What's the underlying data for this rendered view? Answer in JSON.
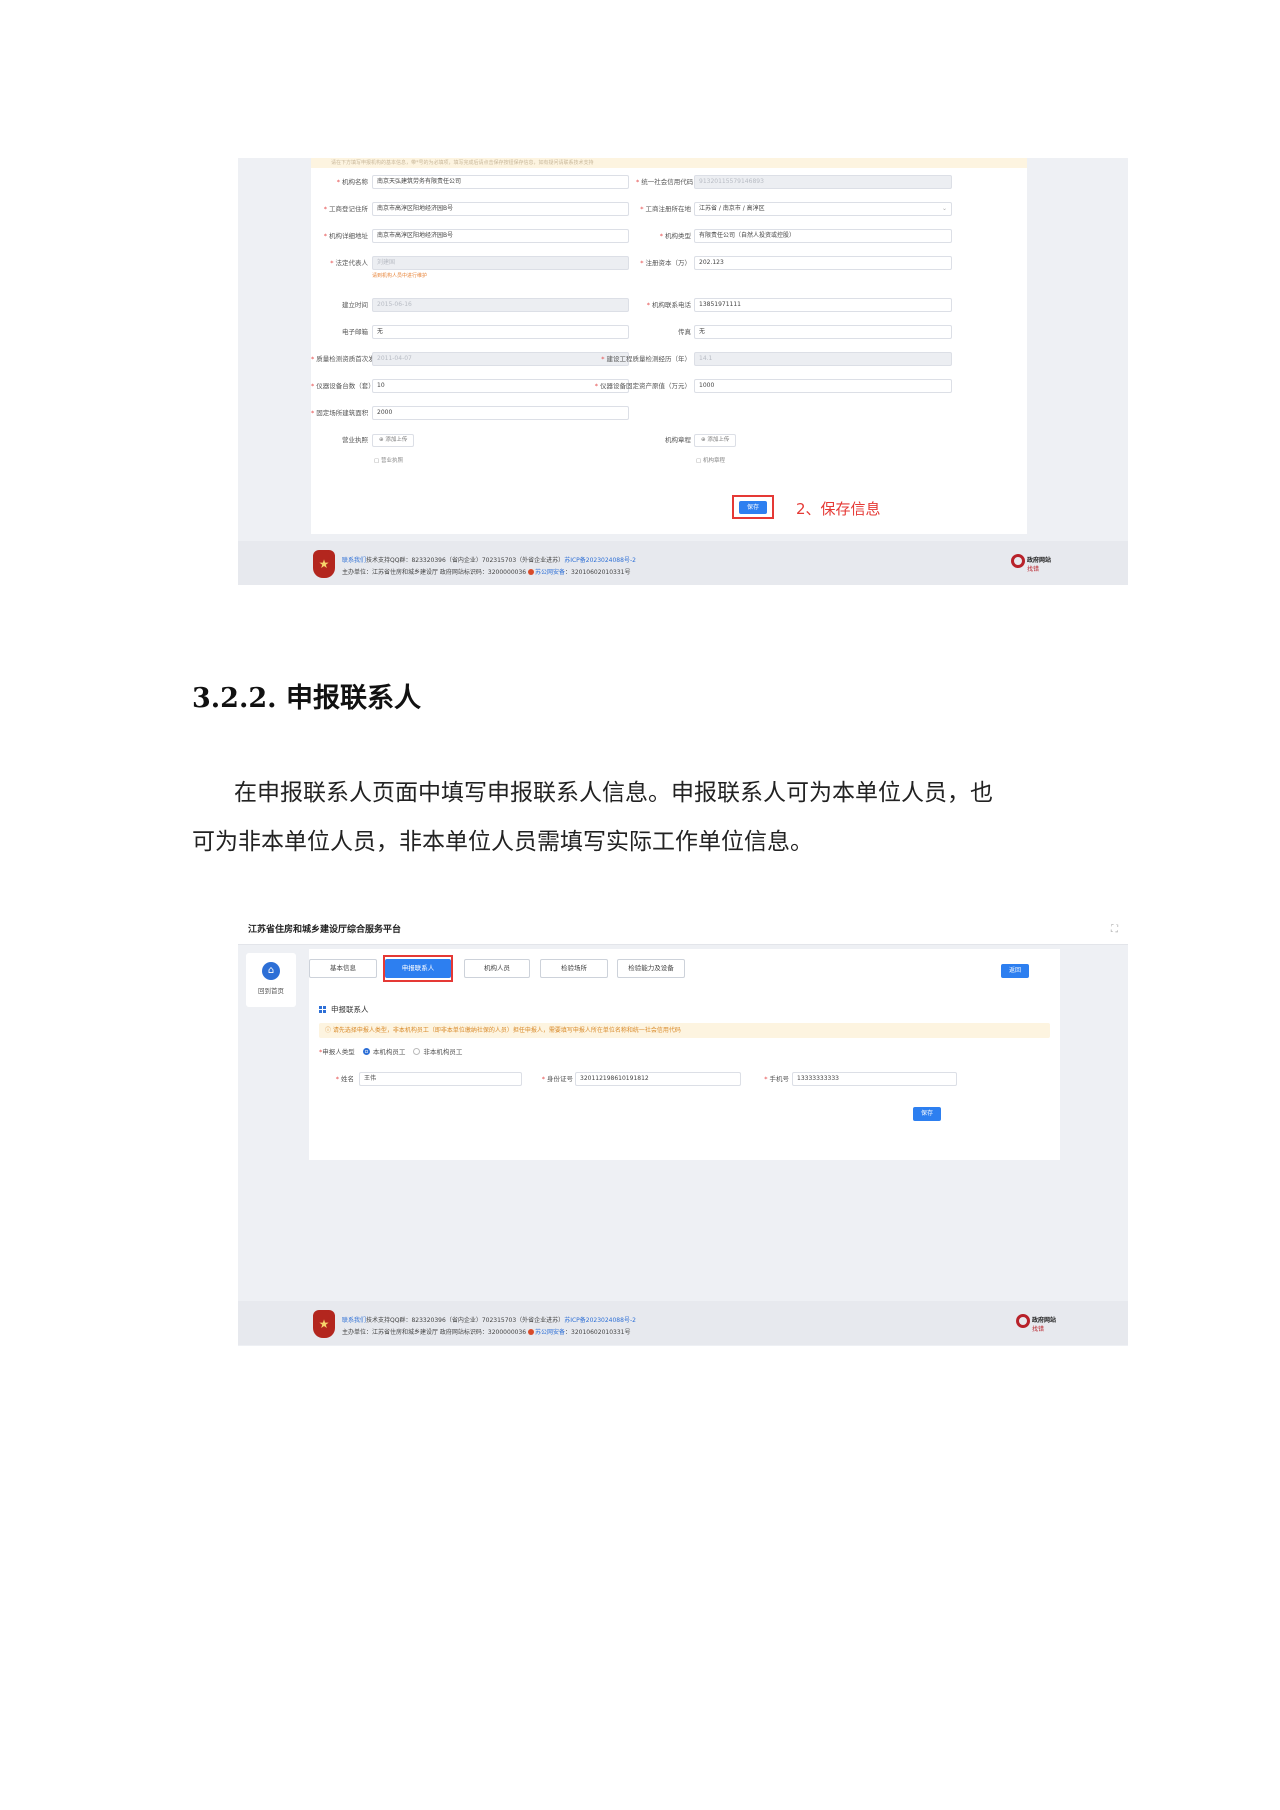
{
  "form1": {
    "notice": "请在下方填写申报机构的基本信息，带*号的为必填项，填写完成后请点击保存按钮保存信息，如有疑问请联系技术支持",
    "fields": {
      "org_name": {
        "label": "机构名称",
        "value": "南京天弘建筑劳务有限责任公司"
      },
      "credit_code": {
        "label": "统一社会信用代码",
        "value": "91320115579146893"
      },
      "reg_address": {
        "label": "工商登记住所",
        "value": "南京市高淳区阳地经济园B号"
      },
      "reg_location": {
        "label": "工商注册所在地",
        "value": "江苏省 / 南京市 / 高淳区"
      },
      "detail_address": {
        "label": "机构详细地址",
        "value": "南京市高淳区阳地经济园B号"
      },
      "org_type": {
        "label": "机构类型",
        "value": "有限责任公司（自然人投资或控股）"
      },
      "legal_rep": {
        "label": "法定代表人",
        "value": "刘建国",
        "hint": "请到机构人员中进行维护"
      },
      "reg_capital": {
        "label": "注册资本（万）",
        "value": "202.123"
      },
      "est_date": {
        "label": "建立时间",
        "value": "2015-06-16"
      },
      "phone": {
        "label": "机构联系电话",
        "value": "13851971111"
      },
      "email": {
        "label": "电子邮箱",
        "value": "无"
      },
      "fax": {
        "label": "传真",
        "value": "无"
      },
      "qual_date": {
        "label": "质量检测资质首次发证时间",
        "value": "2011-04-07"
      },
      "years": {
        "label": "建设工程质量检测经历（年）",
        "value": "14.1"
      },
      "equip_count": {
        "label": "仪器设备台数（套）",
        "value": "10"
      },
      "equip_value": {
        "label": "仪器设备固定资产原值（万元）",
        "value": "1000"
      },
      "area": {
        "label": "固定场所建筑面积（㎡）",
        "value": "2000"
      }
    },
    "license_label": "营业执照",
    "license_upload": "添加上传",
    "license_file": "营业执照",
    "charter_label": "机构章程",
    "charter_upload": "添加上传",
    "charter_file": "机构章程",
    "save": "保存",
    "annotation": "2、保存信息"
  },
  "footer": {
    "emblem": "★",
    "contact_link": "联系我们",
    "line1": "技术支持QQ群：823320396（省内企业）702315703（外省企业进苏）",
    "icp": "苏ICP备2023024088号-2",
    "line2a": "主办单位：江苏省住房和城乡建设厅 政府网站标识码：3200000036",
    "police_link": "苏公网安备",
    "police_num": "：32010602010331号",
    "gov_t1": "政府网站",
    "gov_t2": "找错"
  },
  "heading": "3.2.2. 申报联系人",
  "paragraph": {
    "line1": "在申报联系人页面中填写申报联系人信息。申报联系人可为本单位人员，也",
    "line2": "可为非本单位人员，非本单位人员需填写实际工作单位信息。"
  },
  "app2": {
    "title": "江苏省住房和城乡建设厅综合服务平台",
    "fullscreen_icon": "⛶",
    "home_label": "回到首页",
    "tabs": [
      "基本信息",
      "申报联系人",
      "机构人员",
      "检验场所",
      "检验能力及设备"
    ],
    "back": "返回",
    "section": "申报联系人",
    "notice": "请先选择申报人类型，非本机构员工（即非本单位缴纳社保的人员）担任申报人，需要填写申报人所在单位名称和统一社会信用代码",
    "applicant_type_label": "申报人类型",
    "option_internal": "本机构员工",
    "option_external": "非本机构员工",
    "name_label": "姓名",
    "name_value": "王伟",
    "id_label": "身份证号",
    "id_value": "320112198610191812",
    "phone_label": "手机号",
    "phone_value": "13333333333",
    "save": "保存"
  }
}
